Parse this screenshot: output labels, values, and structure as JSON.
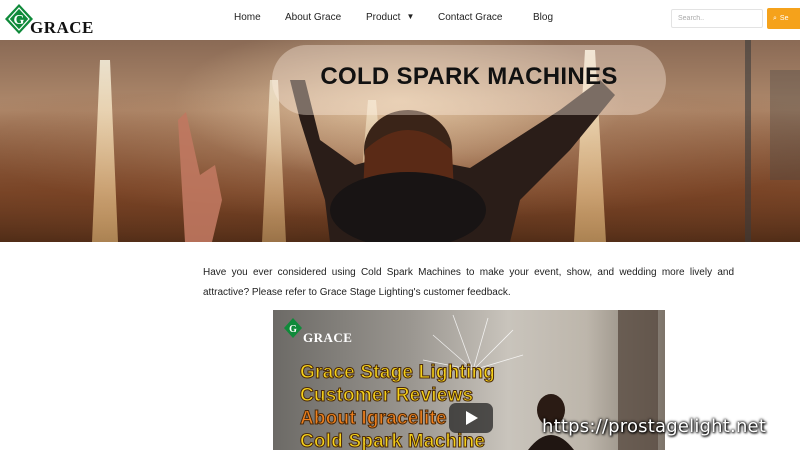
{
  "header": {
    "logo_text": "GRACE",
    "nav": [
      {
        "label": "Home"
      },
      {
        "label": "About Grace"
      },
      {
        "label": "Product"
      },
      {
        "label": "Contact Grace"
      },
      {
        "label": "Blog"
      }
    ],
    "search_placeholder": "Search..",
    "search_button_label": "Se"
  },
  "hero": {
    "title": "COLD SPARK MACHINES"
  },
  "intro": {
    "text": "Have you ever considered using Cold Spark Machines to make your event, show, and wedding more lively and attractive? Please refer to Grace Stage Lighting's customer feedback."
  },
  "video": {
    "logo_text": "GRACE",
    "title_lines": [
      "Grace Stage Lighting",
      "Customer Reviews",
      "About Igracelite",
      "Cold Spark Machine"
    ],
    "title_colors": [
      "#f6d21a",
      "#f6d21a",
      "#f0801d",
      "#f6d21a"
    ]
  },
  "watermark": "https://prostagelight.net",
  "colors": {
    "accent": "#f5a21b",
    "logo_green": "#0f8a3a"
  }
}
